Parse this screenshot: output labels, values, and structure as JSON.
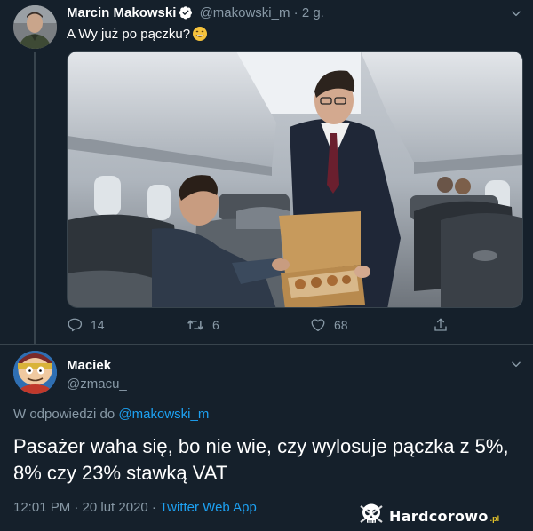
{
  "tweet": {
    "author_name": "Marcin Makowski",
    "author_handle": "@makowski_m",
    "separator": "·",
    "time_ago": "2 g.",
    "text": "A Wy już po pączku?",
    "image_alt": "man in suit holding a box of doughnuts to a seated passenger in an airplane",
    "actions": {
      "reply_count": "14",
      "retweet_count": "6",
      "like_count": "68"
    }
  },
  "reply": {
    "author_name": "Maciek",
    "author_handle": "@zmacu_",
    "replying_prefix": "W odpowiedzi do",
    "replying_to": "@makowski_m",
    "text": "Pasażer waha się, bo nie wie, czy wylosuje pączka z 5%, 8% czy 23% stawką VAT",
    "timestamp": "12:01 PM · 20 lut 2020 ·",
    "source": "Twitter Web App"
  },
  "watermark": {
    "brand": "Hardcorowo",
    "tld": ".pl"
  },
  "colors": {
    "background": "#15202b",
    "secondary_text": "#8899a6",
    "link": "#1da1f2",
    "border": "#38444d"
  }
}
